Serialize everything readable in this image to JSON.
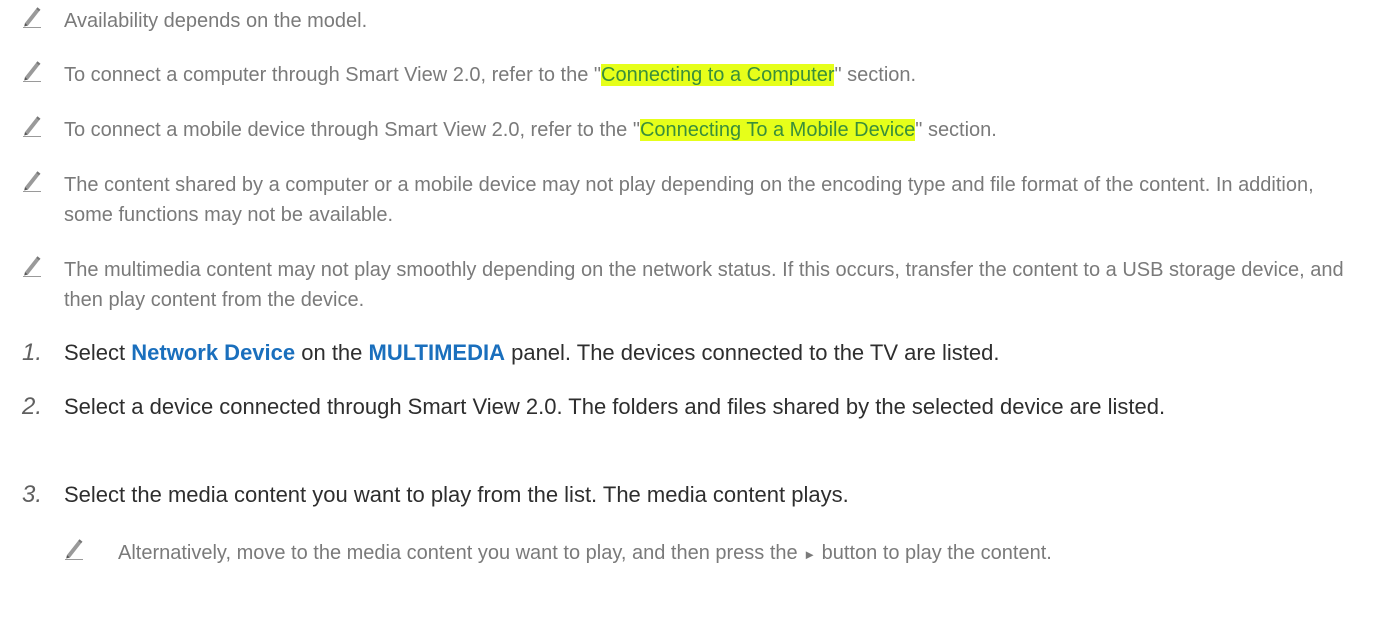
{
  "notes": [
    {
      "text": "Availability depends on the model."
    },
    {
      "before": "To connect a computer through Smart View 2.0, refer to the \"",
      "link": "Connecting to a Computer",
      "after": "\" section."
    },
    {
      "before": "To connect a mobile device through Smart View 2.0, refer to the \"",
      "link": "Connecting To a Mobile Device",
      "after": "\" section."
    },
    {
      "text": "The content shared by a computer or a mobile device may not play depending on the encoding type and file format of the content. In addition, some functions may not be available."
    },
    {
      "text": "The multimedia content may not play smoothly depending on the network status. If this occurs, transfer the content to a USB storage device, and then play content from the device."
    }
  ],
  "steps": [
    {
      "num": "1.",
      "t1": "Select ",
      "k1": "Network Device",
      "t2": " on the ",
      "k2": "MULTIMEDIA",
      "t3": " panel. The devices connected to the TV are listed."
    },
    {
      "num": "2.",
      "text": "Select a device connected through Smart View 2.0. The folders and files shared by the selected device are listed."
    },
    {
      "num": "3.",
      "text": "Select the media content you want to play from the list. The media content plays."
    }
  ],
  "sub_note": {
    "before": "Alternatively, move to the media content you want to play, and then press the ",
    "glyph": "►",
    "after": " button to play the content."
  },
  "icon": "pencil-note-icon"
}
